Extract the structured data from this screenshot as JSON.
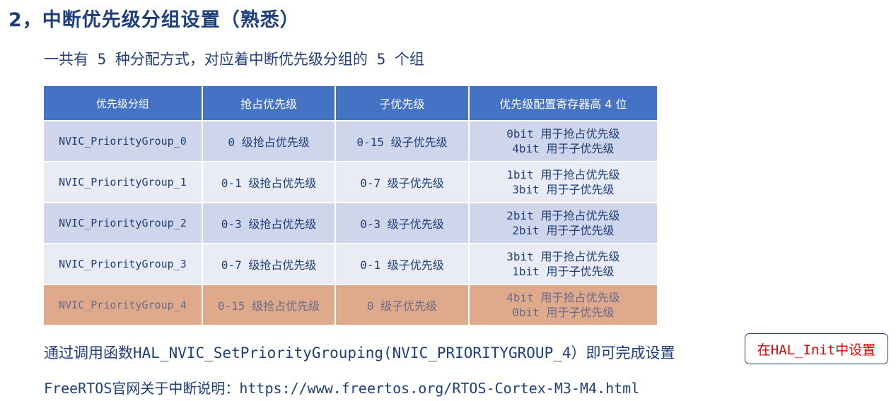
{
  "heading": "2，中断优先级分组设置（熟悉）",
  "subtitle": "一共有 5 种分配方式，对应着中断优先级分组的 5 个组",
  "table": {
    "headers": [
      "优先级分组",
      "抢占优先级",
      "子优先级",
      "优先级配置寄存器高 4 位"
    ],
    "rows": [
      {
        "group": "NVIC_PriorityGroup_0",
        "preempt": "0 级抢占优先级",
        "sub": "0-15 级子优先级",
        "bits_line1": "0bit 用于抢占优先级",
        "bits_line2": "4bit 用于子优先级"
      },
      {
        "group": "NVIC_PriorityGroup_1",
        "preempt": "0-1 级抢占优先级",
        "sub": "0-7 级子优先级",
        "bits_line1": "1bit 用于抢占优先级",
        "bits_line2": "3bit 用于子优先级"
      },
      {
        "group": "NVIC_PriorityGroup_2",
        "preempt": "0-3 级抢占优先级",
        "sub": "0-3 级子优先级",
        "bits_line1": "2bit 用于抢占优先级",
        "bits_line2": "2bit 用于子优先级"
      },
      {
        "group": "NVIC_PriorityGroup_3",
        "preempt": "0-7 级抢占优先级",
        "sub": "0-1 级子优先级",
        "bits_line1": "3bit 用于抢占优先级",
        "bits_line2": "1bit 用于子优先级"
      },
      {
        "group": "NVIC_PriorityGroup_4",
        "preempt": "0-15 级抢占优先级",
        "sub": "0 级子优先级",
        "bits_line1": "4bit 用于抢占优先级",
        "bits_line2": "0bit 用于子优先级"
      }
    ],
    "highlighted_row": 4
  },
  "call_text": "通过调用函数HAL_NVIC_SetPriorityGrouping(NVIC_PRIORITYGROUP_4）即可完成设置",
  "note": "在HAL_Init中设置",
  "link_text": "FreeRTOS官网关于中断说明：https://www.freertos.org/RTOS-Cortex-M3-M4.html",
  "colors": {
    "header_bg": "#4472c4",
    "row_dark": "#cfd5ea",
    "row_light": "#e9ebf5",
    "row_highlight": "#dfa98c",
    "text": "#1f3f7a",
    "note_text": "#e00000"
  }
}
